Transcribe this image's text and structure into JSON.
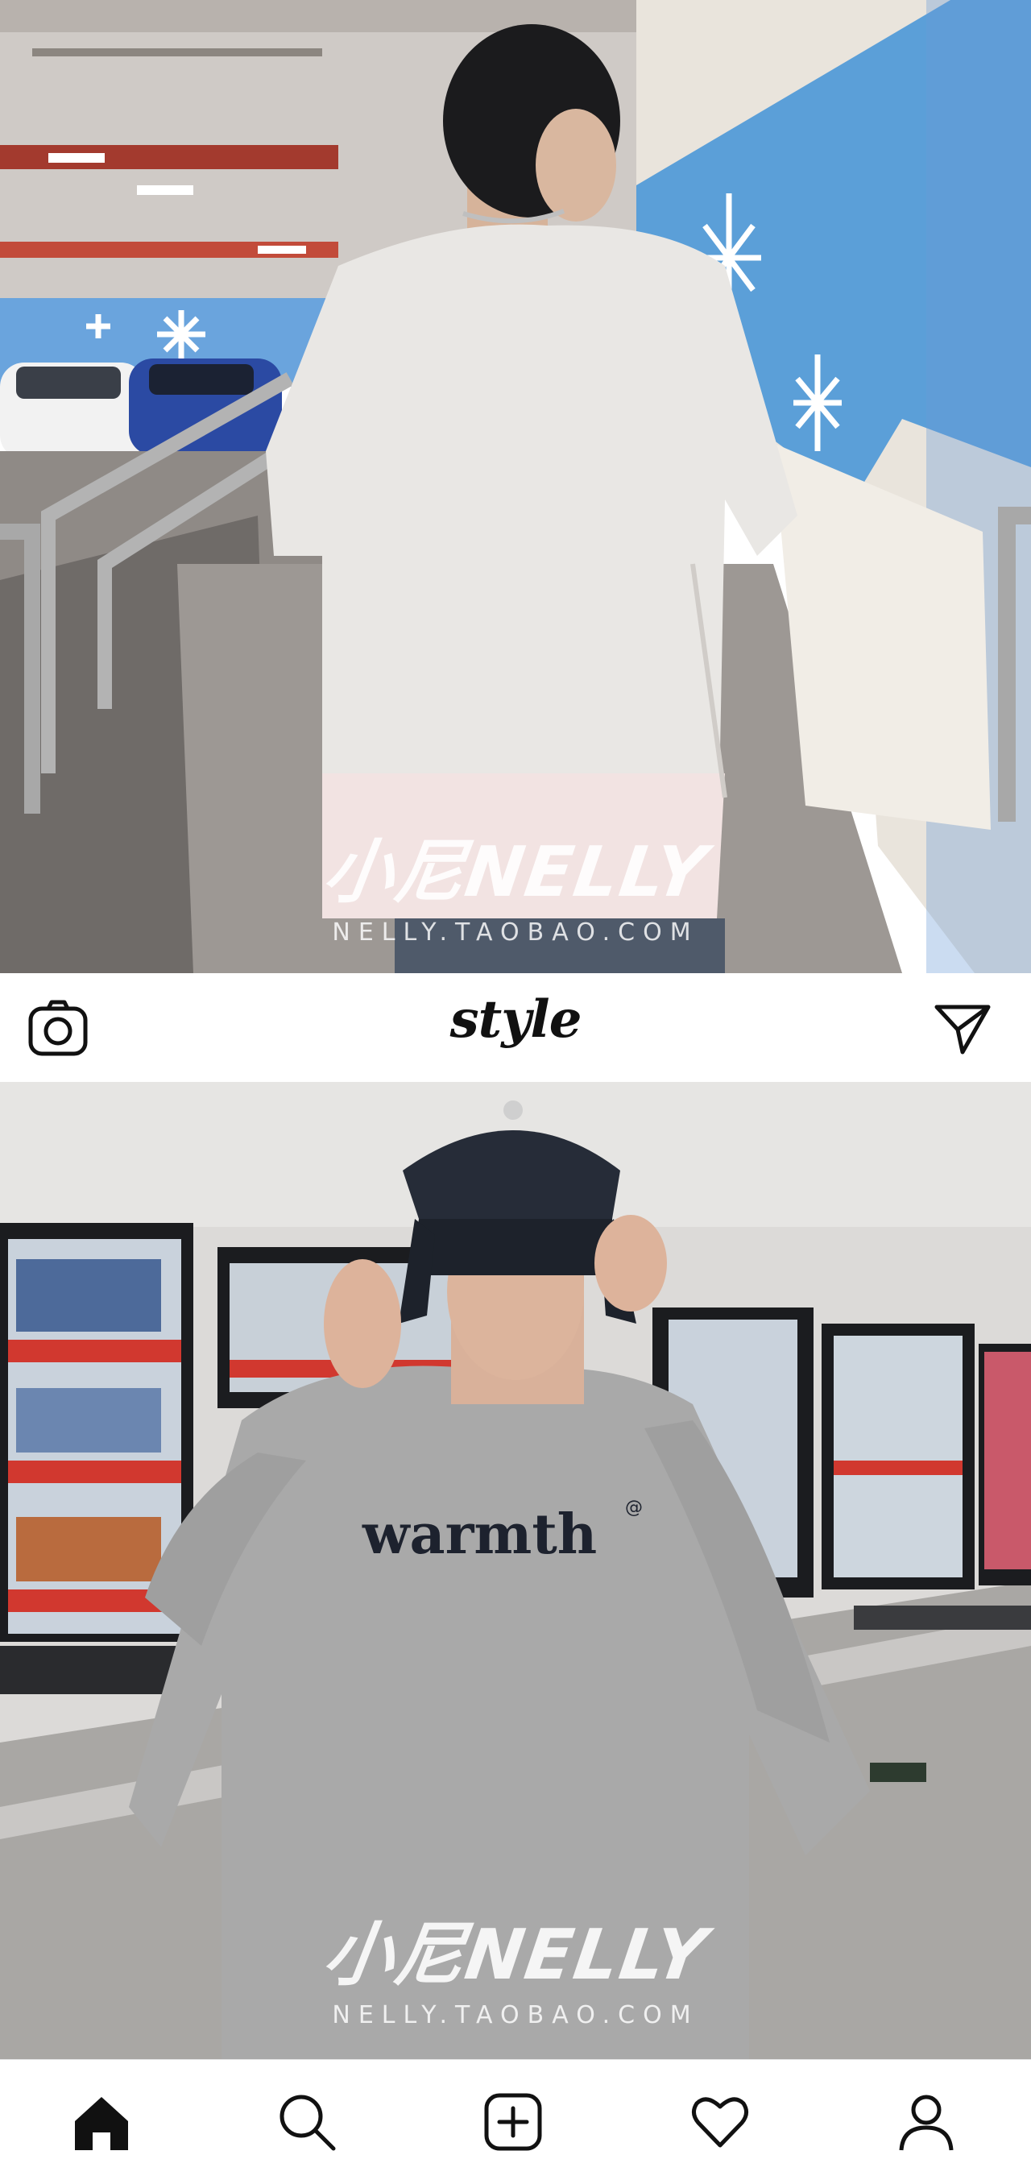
{
  "header": {
    "logo_text": "style"
  },
  "photos": [
    {
      "watermark_brand": "小尼NELLY",
      "watermark_url": "NELLY.TAOBAO.COM"
    },
    {
      "shirt_text": "warmth",
      "shirt_mark": "@",
      "watermark_brand": "小尼NELLY",
      "watermark_url": "NELLY.TAOBAO.COM"
    }
  ],
  "icons": {
    "camera": "camera-icon",
    "send": "send-icon",
    "home": "home-icon",
    "search": "search-icon",
    "add": "add-post-icon",
    "likes": "heart-icon",
    "profile": "profile-icon"
  },
  "colors": {
    "wall_blue": "#5b9fd8",
    "shirt_white": "#e9e7e4",
    "shirt_gray": "#a9a9a9",
    "icon_black": "#111111"
  }
}
